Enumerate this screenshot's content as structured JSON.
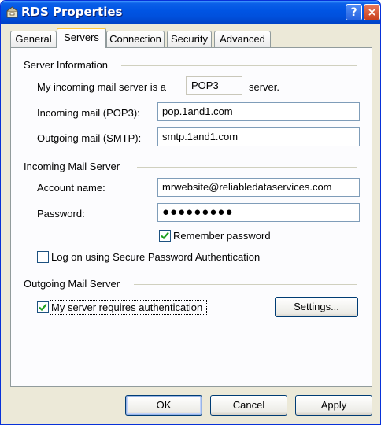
{
  "window": {
    "title": "RDS Properties",
    "help_button": "?",
    "close_button": "×"
  },
  "tabs": [
    {
      "label": "General",
      "active": false
    },
    {
      "label": "Servers",
      "active": true
    },
    {
      "label": "Connection",
      "active": false
    },
    {
      "label": "Security",
      "active": false
    },
    {
      "label": "Advanced",
      "active": false
    }
  ],
  "server_info": {
    "heading": "Server Information",
    "incoming_type_prefix": "My incoming mail server is a",
    "incoming_type_value": "POP3",
    "incoming_type_suffix": "server.",
    "incoming_label": "Incoming mail (POP3):",
    "incoming_value": "pop.1and1.com",
    "outgoing_label": "Outgoing mail (SMTP):",
    "outgoing_value": "smtp.1and1.com"
  },
  "incoming_server": {
    "heading": "Incoming Mail Server",
    "account_label": "Account name:",
    "account_value": "mrwebsite@reliabledataservices.com",
    "password_label": "Password:",
    "password_value": "●●●●●●●●●",
    "remember_label": "Remember password",
    "remember_checked": true,
    "spa_label": "Log on using Secure Password Authentication",
    "spa_checked": false
  },
  "outgoing_server": {
    "heading": "Outgoing Mail Server",
    "auth_label": "My server requires authentication",
    "auth_checked": true,
    "settings_button": "Settings..."
  },
  "buttons": {
    "ok": "OK",
    "cancel": "Cancel",
    "apply": "Apply"
  },
  "colors": {
    "titlebar": "#0054e3",
    "dialog_bg": "#ece9d8",
    "checkmark": "#21a121",
    "active_tab_accent": "#ffc83c"
  }
}
